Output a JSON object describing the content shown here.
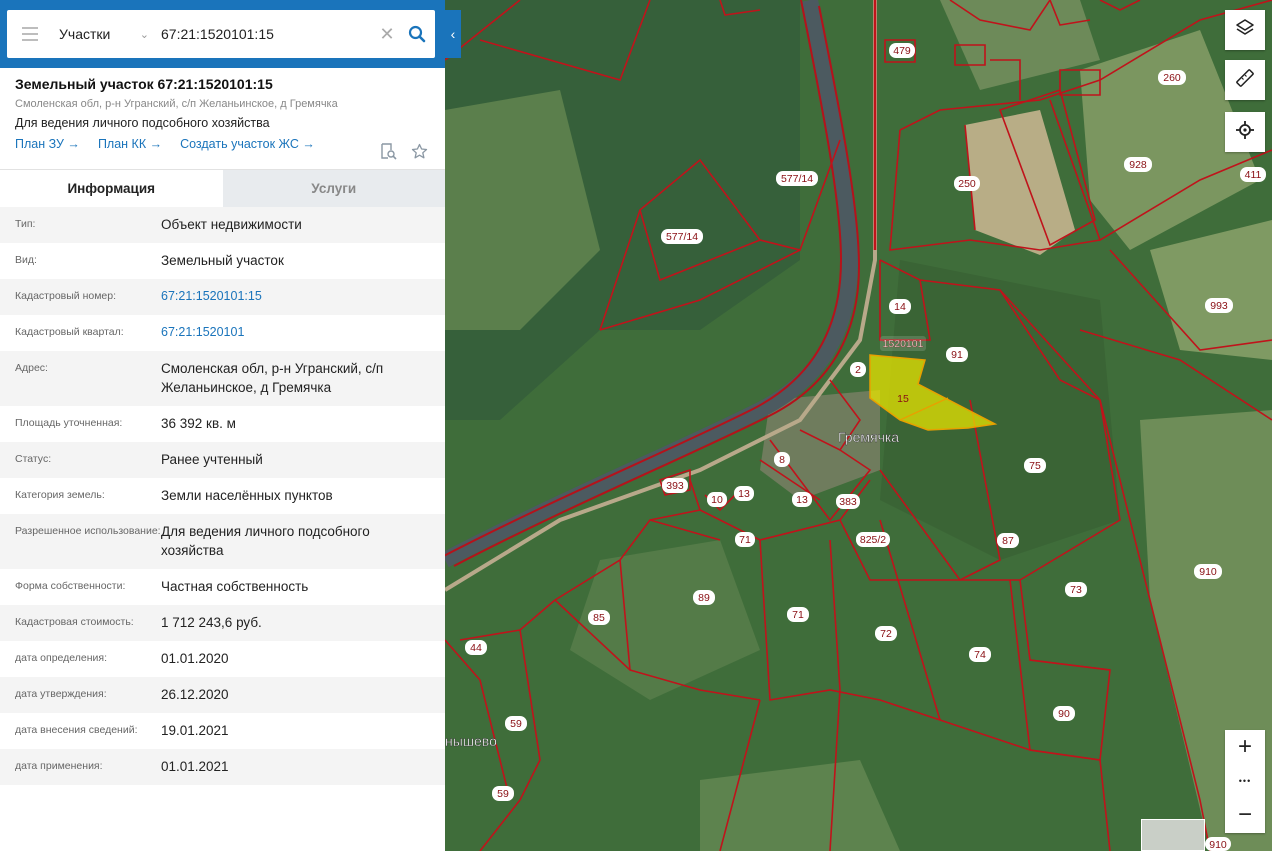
{
  "search": {
    "type_label": "Участки",
    "query": "67:21:1520101:15"
  },
  "object": {
    "title": "Земельный участок 67:21:1520101:15",
    "address": "Смоленская обл, р-н Угранский, с/п Желаньинское, д Гремячка",
    "use": "Для ведения личного подсобного хозяйства",
    "links": [
      "План ЗУ →",
      "План КК →",
      "Создать участок ЖС →"
    ]
  },
  "tabs": [
    "Информация",
    "Услуги"
  ],
  "info": [
    {
      "label": "Тип:",
      "value": "Объект недвижимости"
    },
    {
      "label": "Вид:",
      "value": "Земельный участок"
    },
    {
      "label": "Кадастровый номер:",
      "value": "67:21:1520101:15"
    },
    {
      "label": "Кадастровый квартал:",
      "value": "67:21:1520101"
    },
    {
      "label": "Адрес:",
      "value": "Смоленская обл, р-н Угранский, с/п Желаньинское, д Гремячка"
    },
    {
      "label": "Площадь уточненная:",
      "value": "36 392 кв. м"
    },
    {
      "label": "Статус:",
      "value": "Ранее учтенный"
    },
    {
      "label": "Категория земель:",
      "value": "Земли населённых пунктов"
    },
    {
      "label": "Разрешенное использование:",
      "value": "Для ведения личного подсобного хозяйства"
    },
    {
      "label": "Форма собственности:",
      "value": "Частная собственность"
    },
    {
      "label": "Кадастровая стоимость:",
      "value": "1 712 243,6 руб."
    },
    {
      "label": "дата определения:",
      "value": "01.01.2020"
    },
    {
      "label": "дата утверждения:",
      "value": "26.12.2020"
    },
    {
      "label": "дата внесения сведений:",
      "value": "19.01.2021"
    },
    {
      "label": "дата применения:",
      "value": "01.01.2021"
    }
  ],
  "map": {
    "village_label": "Гремячка",
    "village2_label": "нышево",
    "quarter_label": "1520101",
    "selected_parcel": "15",
    "parcel_labels": [
      "479",
      "260",
      "928",
      "411",
      "250",
      "577/14",
      "577/14",
      "14",
      "91",
      "2",
      "993",
      "75",
      "393",
      "10",
      "13",
      "13",
      "8",
      "15",
      "383",
      "825/2",
      "71",
      "87",
      "910",
      "73",
      "85",
      "89",
      "71",
      "72",
      "74",
      "44",
      "59",
      "90",
      "59",
      "910"
    ]
  },
  "controls": {
    "layers_icon": "layers-icon",
    "ruler_icon": "ruler-icon",
    "locate_icon": "crosshair-icon",
    "zoom_in": "+",
    "zoom_more": "•••",
    "zoom_out": "−"
  },
  "colors": {
    "brand_blue": "#1a74bb",
    "parcel_border": "#c0131b",
    "selected_fill": "#e7e400"
  }
}
